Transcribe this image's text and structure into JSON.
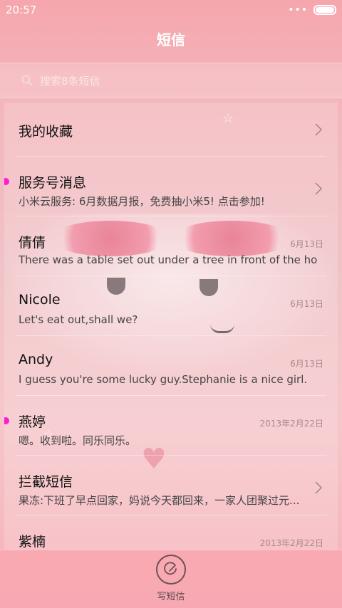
{
  "status_bar": {
    "time": "20:57",
    "more": "•••"
  },
  "header": {
    "title": "短信"
  },
  "search": {
    "placeholder": "搜索8条短信"
  },
  "conversations": [
    {
      "name": "我的收藏",
      "snippet": "",
      "date": "",
      "unread": false,
      "has_chevron": true
    },
    {
      "name": "服务号消息",
      "snippet": "小米云服务: 6月数据月报，免费抽小米5! 点击参加!",
      "date": "",
      "unread": true,
      "has_chevron": true
    },
    {
      "name": "倩倩",
      "snippet": "There was a table set out under a tree in front of the hous",
      "date": "6月13日",
      "unread": false,
      "has_chevron": false
    },
    {
      "name": "Nicole",
      "snippet": "Let's eat out,shall we?",
      "date": "6月13日",
      "unread": false,
      "has_chevron": false
    },
    {
      "name": "Andy",
      "snippet": "I guess you're some lucky guy.Stephanie is a nice girl.",
      "date": "6月13日",
      "unread": false,
      "has_chevron": false
    },
    {
      "name": "燕婷",
      "snippet": "嗯。收到啦。同乐同乐。",
      "date": "2013年2月22日",
      "unread": true,
      "has_chevron": false
    },
    {
      "name": "拦截短信",
      "snippet": "果冻:下班了早点回家，妈说今天都回来，一家人团聚过元...",
      "date": "",
      "unread": false,
      "has_chevron": true
    },
    {
      "name": "紫楠",
      "snippet": "",
      "date": "2013年2月22日",
      "unread": false,
      "has_chevron": false
    }
  ],
  "bottom_bar": {
    "compose_label": "写短信"
  },
  "colors": {
    "unread_dot": "#ff1ccf",
    "title_text": "#ffffff"
  }
}
